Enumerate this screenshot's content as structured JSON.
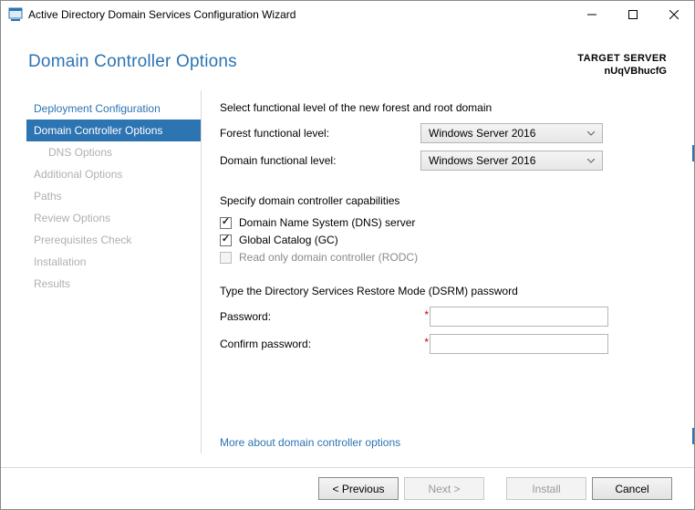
{
  "window": {
    "title": "Active Directory Domain Services Configuration Wizard"
  },
  "header": {
    "page_title": "Domain Controller Options",
    "target_label": "TARGET SERVER",
    "target_value": "nUqVBhucfG"
  },
  "sidebar": {
    "items": [
      {
        "label": "Deployment Configuration",
        "state": "normal"
      },
      {
        "label": "Domain Controller Options",
        "state": "active"
      },
      {
        "label": "DNS Options",
        "state": "disabled",
        "indent": true
      },
      {
        "label": "Additional Options",
        "state": "disabled"
      },
      {
        "label": "Paths",
        "state": "disabled"
      },
      {
        "label": "Review Options",
        "state": "disabled"
      },
      {
        "label": "Prerequisites Check",
        "state": "disabled"
      },
      {
        "label": "Installation",
        "state": "disabled"
      },
      {
        "label": "Results",
        "state": "disabled"
      }
    ]
  },
  "content": {
    "functional_intro": "Select functional level of the new forest and root domain",
    "forest_label": "Forest functional level:",
    "forest_value": "Windows Server 2016",
    "domain_label": "Domain functional level:",
    "domain_value": "Windows Server 2016",
    "capabilities_label": "Specify domain controller capabilities",
    "cb_dns": "Domain Name System (DNS) server",
    "cb_gc": "Global Catalog (GC)",
    "cb_rodc": "Read only domain controller (RODC)",
    "dsrm_intro": "Type the Directory Services Restore Mode (DSRM) password",
    "password_label": "Password:",
    "confirm_label": "Confirm password:",
    "password_value": "",
    "confirm_value": "",
    "more_link": "More about domain controller options"
  },
  "footer": {
    "previous": "< Previous",
    "next": "Next >",
    "install": "Install",
    "cancel": "Cancel"
  }
}
